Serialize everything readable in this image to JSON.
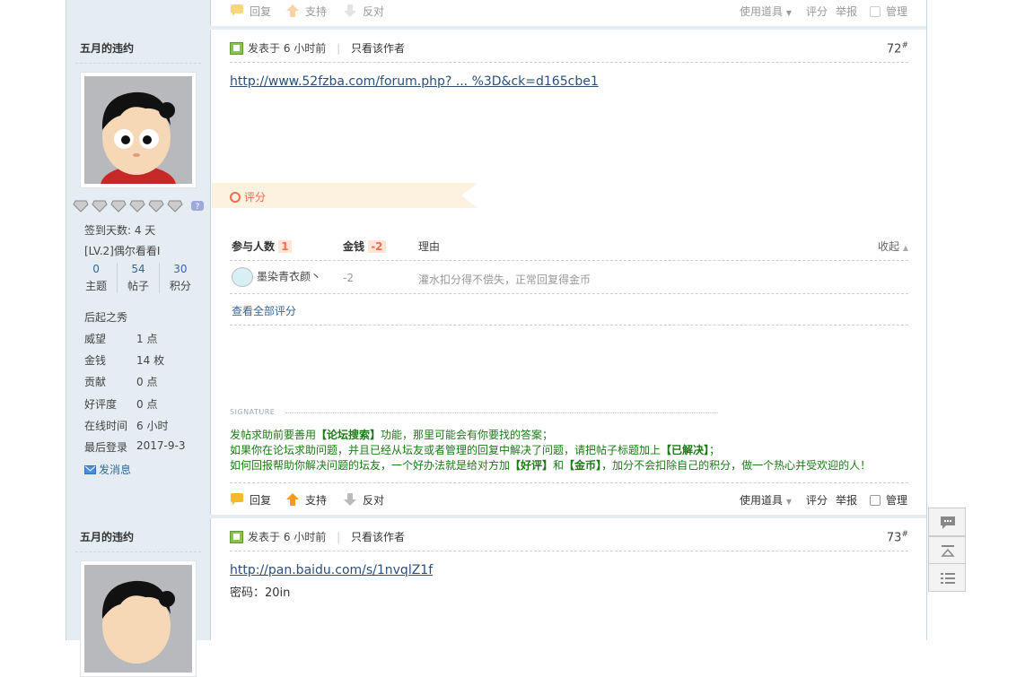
{
  "top_bar": {
    "reply": "回复",
    "support": "支持",
    "oppose": "反对",
    "tools": "使用道具",
    "rate": "评分",
    "report": "举报",
    "manage": "管理"
  },
  "post1": {
    "username": "五月的违约",
    "posted": "发表于 6 小时前",
    "author_only": "只看该作者",
    "floor": "72",
    "floor_mark": "#",
    "link": "http://www.52fzba.com/forum.php? ... %3D&ck=d165cbe1",
    "user": {
      "checkin": "签到天数: 4 天",
      "level": "[LV.2]偶尔看看I",
      "stats": [
        {
          "value": "0",
          "label": "主题"
        },
        {
          "value": "54",
          "label": "帖子"
        },
        {
          "value": "30",
          "label": "积分"
        }
      ],
      "group": "后起之秀",
      "fields": [
        {
          "label": "威望",
          "value": "1 点"
        },
        {
          "label": "金钱",
          "value": "14 枚"
        },
        {
          "label": "贡献",
          "value": "0 点"
        },
        {
          "label": "好评度",
          "value": "0 点"
        },
        {
          "label": "在线时间",
          "value": "6 小时"
        },
        {
          "label": "最后登录",
          "value": "2017-9-3"
        }
      ],
      "message": "发消息"
    },
    "rating": {
      "title": "评分",
      "participants_label": "参与人数",
      "participants": "1",
      "money_label": "金钱",
      "money": "-2",
      "reason_label": "理由",
      "collapse": "收起",
      "rows": [
        {
          "user": "墨染青衣颜丶",
          "money": "-2",
          "reason": "灌水扣分得不偿失，正常回复得金币"
        }
      ],
      "view_all": "查看全部评分"
    },
    "signature": {
      "label": "SIGNATURE",
      "line1_a": "发帖求助前要善用",
      "line1_b": "【论坛搜索】",
      "line1_c": "功能，那里可能会有你要找的答案；",
      "line2_a": "如果你在论坛求助问题，并且已经从坛友或者管理的回复中解决了问题，请把帖子标题加上",
      "line2_b": "【已解决】",
      "line2_c": "；",
      "line3_a": "如何回报帮助你解决问题的坛友，一个好办法就是给对方加",
      "line3_b": "【好评】",
      "line3_c": "和",
      "line3_d": "【金币】",
      "line3_e": "，加分不会扣除自己的积分，做一个热心并受欢迎的人！"
    },
    "actions": {
      "reply": "回复",
      "support": "支持",
      "oppose": "反对",
      "tools": "使用道具",
      "rate": "评分",
      "report": "举报",
      "manage": "管理"
    }
  },
  "post2": {
    "username": "五月的违约",
    "posted": "发表于 6 小时前",
    "author_only": "只看该作者",
    "floor": "73",
    "floor_mark": "#",
    "link": "http://pan.baidu.com/s/1nvqlZ1f",
    "password": "密码：20in"
  },
  "float": {
    "icons": [
      "comment-icon",
      "back-to-top-icon",
      "list-icon"
    ]
  },
  "colors": {
    "sidebar_bg": "#e5edf2",
    "border": "#c2d5e3",
    "signature_green": "#1b7a16",
    "rate_orange": "#f26c4f"
  }
}
